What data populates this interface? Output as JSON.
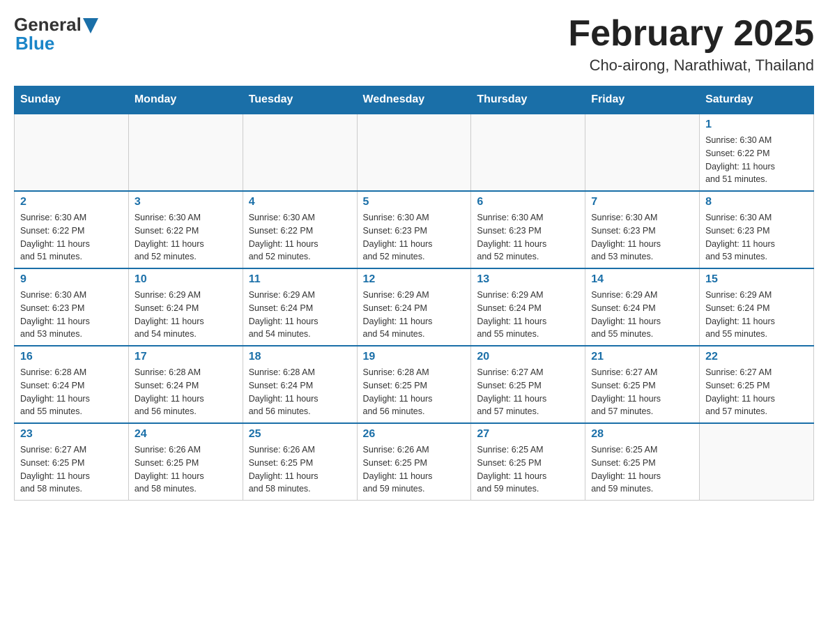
{
  "header": {
    "title": "February 2025",
    "subtitle": "Cho-airong, Narathiwat, Thailand",
    "logo_general": "General",
    "logo_blue": "Blue"
  },
  "days_of_week": [
    "Sunday",
    "Monday",
    "Tuesday",
    "Wednesday",
    "Thursday",
    "Friday",
    "Saturday"
  ],
  "weeks": [
    [
      {
        "day": "",
        "info": ""
      },
      {
        "day": "",
        "info": ""
      },
      {
        "day": "",
        "info": ""
      },
      {
        "day": "",
        "info": ""
      },
      {
        "day": "",
        "info": ""
      },
      {
        "day": "",
        "info": ""
      },
      {
        "day": "1",
        "info": "Sunrise: 6:30 AM\nSunset: 6:22 PM\nDaylight: 11 hours\nand 51 minutes."
      }
    ],
    [
      {
        "day": "2",
        "info": "Sunrise: 6:30 AM\nSunset: 6:22 PM\nDaylight: 11 hours\nand 51 minutes."
      },
      {
        "day": "3",
        "info": "Sunrise: 6:30 AM\nSunset: 6:22 PM\nDaylight: 11 hours\nand 52 minutes."
      },
      {
        "day": "4",
        "info": "Sunrise: 6:30 AM\nSunset: 6:22 PM\nDaylight: 11 hours\nand 52 minutes."
      },
      {
        "day": "5",
        "info": "Sunrise: 6:30 AM\nSunset: 6:23 PM\nDaylight: 11 hours\nand 52 minutes."
      },
      {
        "day": "6",
        "info": "Sunrise: 6:30 AM\nSunset: 6:23 PM\nDaylight: 11 hours\nand 52 minutes."
      },
      {
        "day": "7",
        "info": "Sunrise: 6:30 AM\nSunset: 6:23 PM\nDaylight: 11 hours\nand 53 minutes."
      },
      {
        "day": "8",
        "info": "Sunrise: 6:30 AM\nSunset: 6:23 PM\nDaylight: 11 hours\nand 53 minutes."
      }
    ],
    [
      {
        "day": "9",
        "info": "Sunrise: 6:30 AM\nSunset: 6:23 PM\nDaylight: 11 hours\nand 53 minutes."
      },
      {
        "day": "10",
        "info": "Sunrise: 6:29 AM\nSunset: 6:24 PM\nDaylight: 11 hours\nand 54 minutes."
      },
      {
        "day": "11",
        "info": "Sunrise: 6:29 AM\nSunset: 6:24 PM\nDaylight: 11 hours\nand 54 minutes."
      },
      {
        "day": "12",
        "info": "Sunrise: 6:29 AM\nSunset: 6:24 PM\nDaylight: 11 hours\nand 54 minutes."
      },
      {
        "day": "13",
        "info": "Sunrise: 6:29 AM\nSunset: 6:24 PM\nDaylight: 11 hours\nand 55 minutes."
      },
      {
        "day": "14",
        "info": "Sunrise: 6:29 AM\nSunset: 6:24 PM\nDaylight: 11 hours\nand 55 minutes."
      },
      {
        "day": "15",
        "info": "Sunrise: 6:29 AM\nSunset: 6:24 PM\nDaylight: 11 hours\nand 55 minutes."
      }
    ],
    [
      {
        "day": "16",
        "info": "Sunrise: 6:28 AM\nSunset: 6:24 PM\nDaylight: 11 hours\nand 55 minutes."
      },
      {
        "day": "17",
        "info": "Sunrise: 6:28 AM\nSunset: 6:24 PM\nDaylight: 11 hours\nand 56 minutes."
      },
      {
        "day": "18",
        "info": "Sunrise: 6:28 AM\nSunset: 6:24 PM\nDaylight: 11 hours\nand 56 minutes."
      },
      {
        "day": "19",
        "info": "Sunrise: 6:28 AM\nSunset: 6:25 PM\nDaylight: 11 hours\nand 56 minutes."
      },
      {
        "day": "20",
        "info": "Sunrise: 6:27 AM\nSunset: 6:25 PM\nDaylight: 11 hours\nand 57 minutes."
      },
      {
        "day": "21",
        "info": "Sunrise: 6:27 AM\nSunset: 6:25 PM\nDaylight: 11 hours\nand 57 minutes."
      },
      {
        "day": "22",
        "info": "Sunrise: 6:27 AM\nSunset: 6:25 PM\nDaylight: 11 hours\nand 57 minutes."
      }
    ],
    [
      {
        "day": "23",
        "info": "Sunrise: 6:27 AM\nSunset: 6:25 PM\nDaylight: 11 hours\nand 58 minutes."
      },
      {
        "day": "24",
        "info": "Sunrise: 6:26 AM\nSunset: 6:25 PM\nDaylight: 11 hours\nand 58 minutes."
      },
      {
        "day": "25",
        "info": "Sunrise: 6:26 AM\nSunset: 6:25 PM\nDaylight: 11 hours\nand 58 minutes."
      },
      {
        "day": "26",
        "info": "Sunrise: 6:26 AM\nSunset: 6:25 PM\nDaylight: 11 hours\nand 59 minutes."
      },
      {
        "day": "27",
        "info": "Sunrise: 6:25 AM\nSunset: 6:25 PM\nDaylight: 11 hours\nand 59 minutes."
      },
      {
        "day": "28",
        "info": "Sunrise: 6:25 AM\nSunset: 6:25 PM\nDaylight: 11 hours\nand 59 minutes."
      },
      {
        "day": "",
        "info": ""
      }
    ]
  ]
}
